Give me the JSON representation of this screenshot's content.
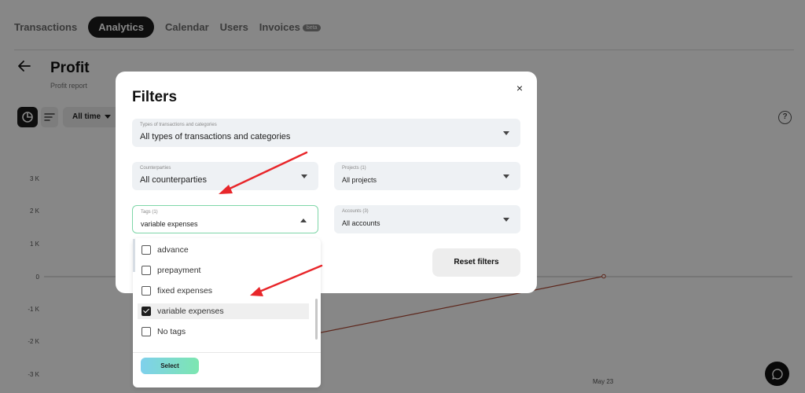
{
  "nav": {
    "tabs": [
      {
        "label": "Transactions"
      },
      {
        "label": "Analytics"
      },
      {
        "label": "Calendar"
      },
      {
        "label": "Users"
      },
      {
        "label": "Invoices"
      }
    ],
    "beta_badge": "beta"
  },
  "page": {
    "title": "Profit",
    "subtitle": "Profit report"
  },
  "toolbar": {
    "period": "All time"
  },
  "chart_data": {
    "type": "line",
    "y_ticks": [
      "3 K",
      "2 K",
      "1 K",
      "0",
      "-1 K",
      "-2 K",
      "-3 K"
    ],
    "x_labels": [
      "May 23"
    ],
    "ylim": [
      -3000,
      3000
    ],
    "series": [
      {
        "x": [
          "",
          "May 23"
        ],
        "values": [
          -2100,
          0
        ],
        "color": "#b04a35"
      }
    ]
  },
  "modal": {
    "title": "Filters",
    "close_symbol": "×",
    "types": {
      "label": "Types of transactions and categories",
      "value": "All types of transactions and categories"
    },
    "counterparties": {
      "label": "Counterparties",
      "value": "All counterparties"
    },
    "projects": {
      "label": "Projects (1)",
      "value": "All projects"
    },
    "tags": {
      "label": "Tags (1)",
      "value": "variable expenses"
    },
    "accounts": {
      "label": "Accounts (3)",
      "value": "All accounts"
    },
    "reset_label": "Reset filters"
  },
  "tags_dropdown": {
    "options": [
      {
        "label": "advance",
        "checked": false
      },
      {
        "label": "prepayment",
        "checked": false
      },
      {
        "label": "fixed expenses",
        "checked": false
      },
      {
        "label": "variable expenses",
        "checked": true
      },
      {
        "label": "No tags",
        "checked": false
      }
    ],
    "select_label": "Select"
  },
  "colors": {
    "annotation_arrow": "#e8262a",
    "focus_border": "#7fd6a8",
    "nav_active": "#1c1c1c"
  }
}
